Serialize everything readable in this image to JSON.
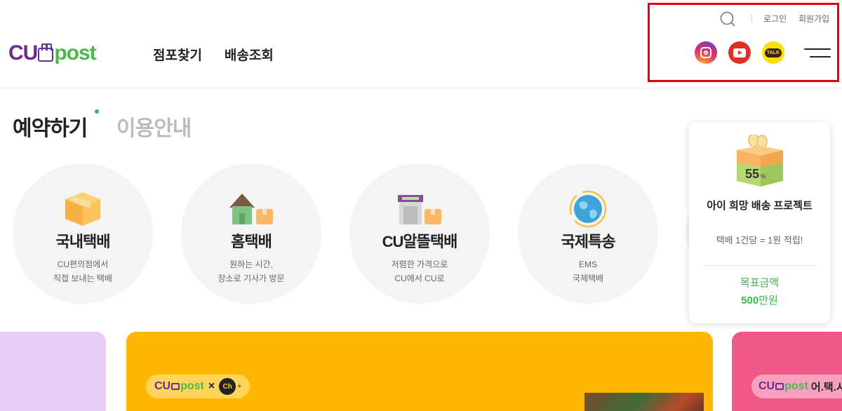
{
  "header": {
    "logo": {
      "cu": "CU",
      "post": "post"
    },
    "nav": [
      {
        "label": "점포찾기"
      },
      {
        "label": "배송조회"
      }
    ],
    "util": {
      "login": "로그인",
      "join": "회원가입"
    },
    "sns": [
      {
        "name": "instagram-icon"
      },
      {
        "name": "youtube-icon"
      },
      {
        "name": "kakaotalk-icon",
        "text": "TALK"
      }
    ]
  },
  "tabs": [
    {
      "label": "예약하기",
      "active": true
    },
    {
      "label": "이용안내",
      "active": false
    }
  ],
  "services": [
    {
      "title": "국내택배",
      "desc1": "CU편의점에서",
      "desc2": "직접 보내는 택배"
    },
    {
      "title": "홈택배",
      "desc1": "원하는 시간,",
      "desc2": "장소로 기사가 방문"
    },
    {
      "title": "CU알뜰택배",
      "desc1": "저렴한 가격으로",
      "desc2": "CU에서 CU로"
    },
    {
      "title": "국제특송",
      "desc1": "EMS",
      "desc2": "국제택배"
    }
  ],
  "project": {
    "percent": "55",
    "percent_unit": "%",
    "title": "아이 희망 배송 프로젝트",
    "desc": "택배 1건당 = 1원 적립!",
    "target_label": "목표금액",
    "amount_num": "500",
    "amount_unit": "만원"
  },
  "banners": {
    "center": {
      "logo_cu": "CU",
      "logo_post": "post",
      "x": "×",
      "ch": "Ch",
      "plus": "+"
    },
    "right": {
      "logo_cu": "CU",
      "logo_post": "post",
      "text": "어.택.시"
    }
  },
  "colors": {
    "brand_purple": "#6a2c91",
    "brand_green": "#4cb84c",
    "highlight_red": "#e60012",
    "banner_yellow": "#ffb703",
    "banner_pink": "#ee5a85",
    "banner_lilac": "#e8cdf4"
  }
}
